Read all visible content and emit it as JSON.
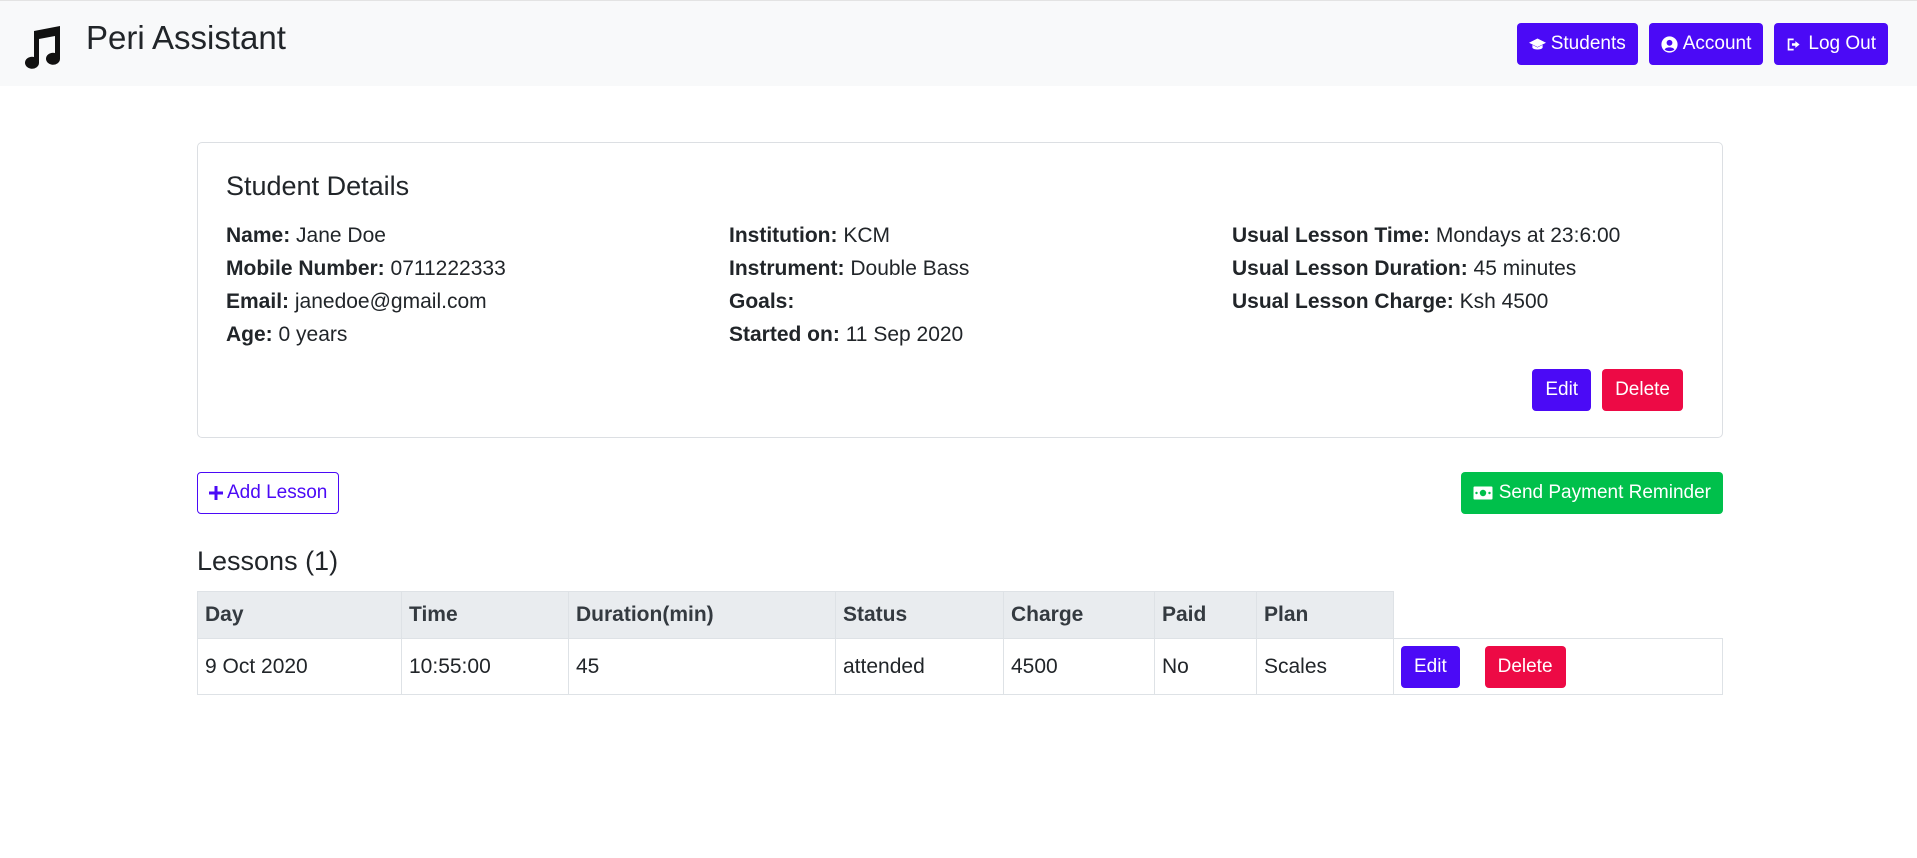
{
  "app": {
    "title": "Peri Assistant",
    "nav": {
      "students": "Students",
      "account": "Account",
      "logout": "Log Out"
    }
  },
  "student": {
    "heading": "Student Details",
    "fields": {
      "name_label": "Name:",
      "name": "Jane Doe",
      "mobile_label": "Mobile Number:",
      "mobile": "0711222333",
      "email_label": "Email:",
      "email": "janedoe@gmail.com",
      "age_label": "Age:",
      "age": "0 years",
      "institution_label": "Institution:",
      "institution": "KCM",
      "instrument_label": "Instrument:",
      "instrument": "Double Bass",
      "goals_label": "Goals:",
      "goals": "",
      "started_label": "Started on:",
      "started": "11 Sep 2020",
      "lesson_time_label": "Usual Lesson Time:",
      "lesson_time": "Mondays at 23:6:00",
      "lesson_duration_label": "Usual Lesson Duration:",
      "lesson_duration": "45 minutes",
      "lesson_charge_label": "Usual Lesson Charge:",
      "lesson_charge": "Ksh 4500"
    },
    "edit_label": "Edit",
    "delete_label": "Delete"
  },
  "actions": {
    "add_lesson": "Add Lesson",
    "send_reminder": "Send Payment Reminder"
  },
  "lessons": {
    "heading": "Lessons (1)",
    "columns": [
      "Day",
      "Time",
      "Duration(min)",
      "Status",
      "Charge",
      "Paid",
      "Plan"
    ],
    "rows": [
      {
        "day": "9 Oct 2020",
        "time": "10:55:00",
        "duration": "45",
        "status": "attended",
        "charge": "4500",
        "paid": "No",
        "plan": "Scales",
        "edit_label": "Edit",
        "delete_label": "Delete"
      }
    ]
  },
  "colors": {
    "primary": "#4b0af6",
    "danger": "#ed0a45",
    "success": "#00c04b",
    "navbar_bg": "#f8f9fa"
  }
}
